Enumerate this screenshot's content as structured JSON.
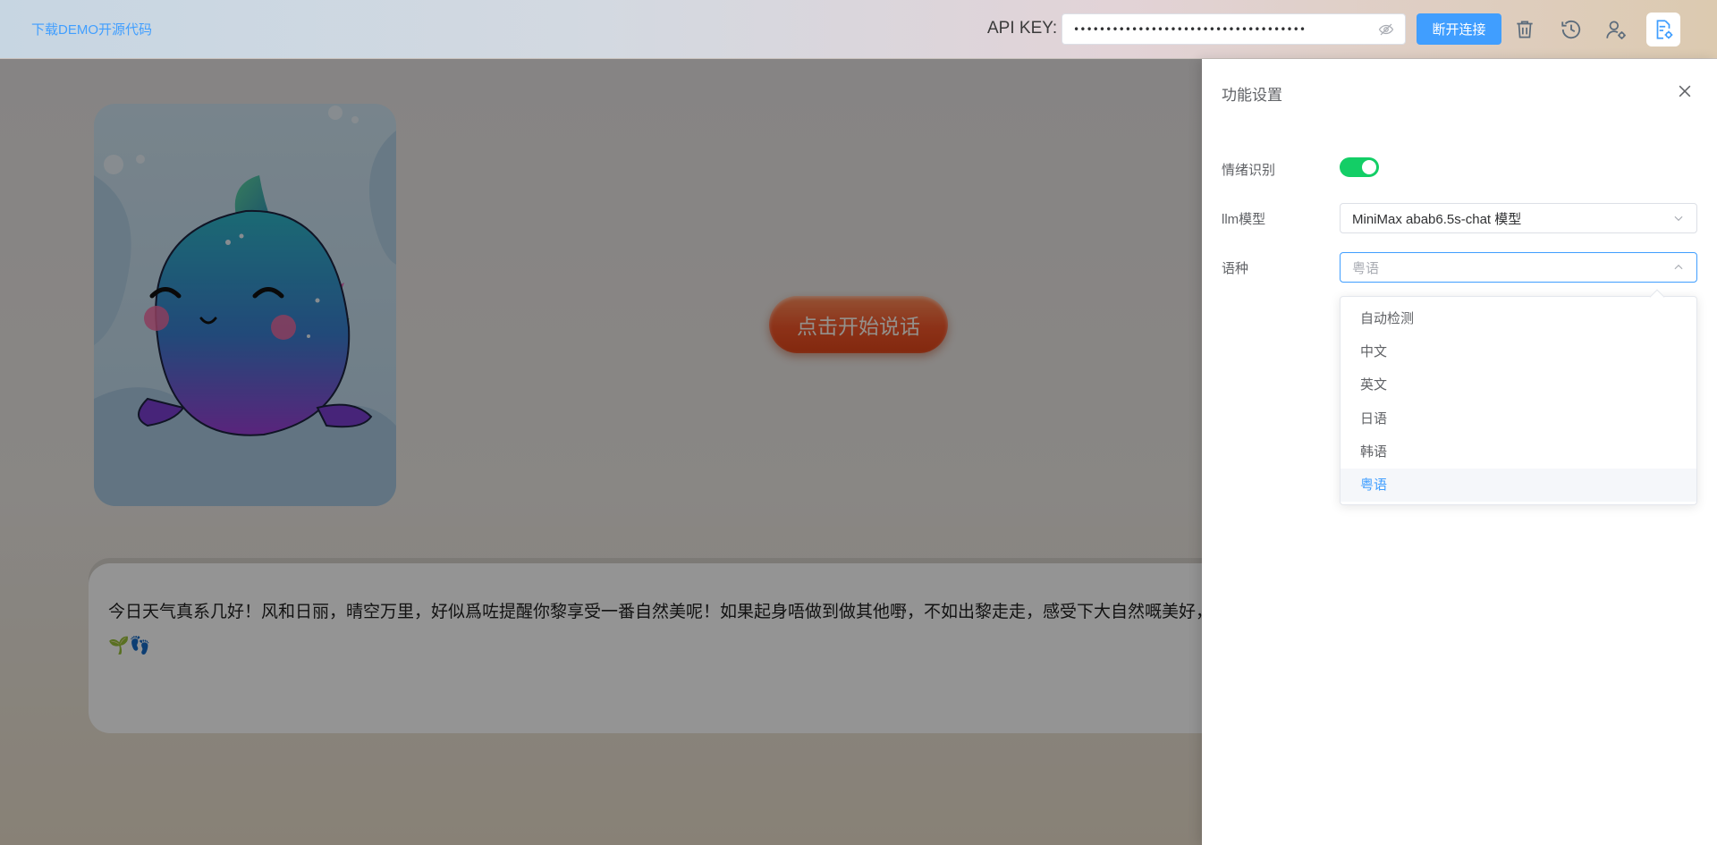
{
  "topbar": {
    "demo_link": "下载DEMO开源代码",
    "api_key_label": "API KEY:",
    "api_key_value": "••••••••••••••••••••••••••••••••••••",
    "disconnect_label": "断开连接",
    "icons": [
      "trash-icon",
      "history-icon",
      "user-settings-icon",
      "settings-doc-icon"
    ]
  },
  "main": {
    "start_button": "点击开始说话",
    "chat_text": "今日天气真系几好！风和日丽，晴空万里，好似爲咗提醒你黎享受一番自然美呢！如果起身唔做到做其他嘢，不如出黎走走，感受下大自然嘅美好，心啦！🌻🌱👣"
  },
  "drawer": {
    "title": "功能设置",
    "emotion_label": "情绪识别",
    "emotion_enabled": true,
    "llm_label": "llm模型",
    "llm_value": "MiniMax abab6.5s-chat 模型",
    "language_label": "语种",
    "language_placeholder": "粤语",
    "language_options": [
      "自动检测",
      "中文",
      "英文",
      "日语",
      "韩语",
      "粤语"
    ],
    "language_selected": "粤语"
  },
  "colors": {
    "primary": "#409eff",
    "switch_on": "#13ce66",
    "start_button": "#f2562a"
  }
}
